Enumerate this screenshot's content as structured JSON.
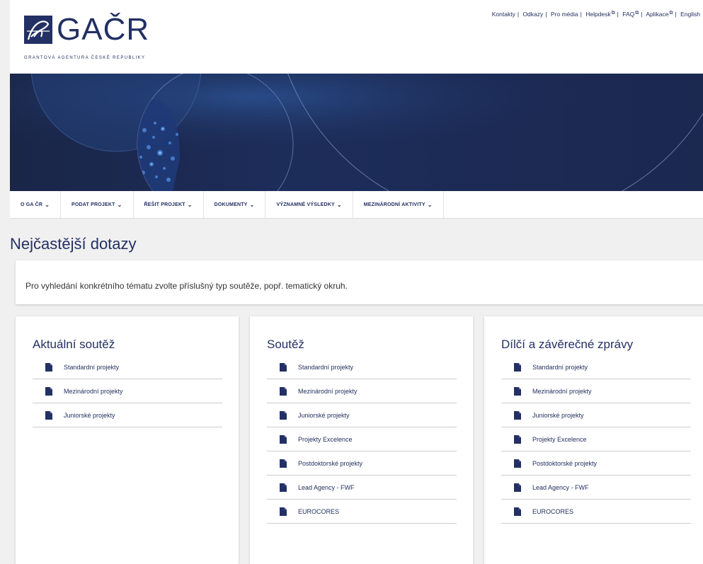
{
  "logo": {
    "name": "GAČR",
    "subtitle": "GRANTOVÁ AGENTURA ČESKÉ REPUBLIKY"
  },
  "toplinks": [
    {
      "label": "Kontakty",
      "external": false
    },
    {
      "label": "Odkazy",
      "external": false
    },
    {
      "label": "Pro média",
      "external": false
    },
    {
      "label": "Helpdesk",
      "external": true
    },
    {
      "label": "FAQ",
      "external": true
    },
    {
      "label": "Aplikace",
      "external": true
    },
    {
      "label": "English",
      "external": false
    }
  ],
  "nav": [
    {
      "label": "O GA ČR"
    },
    {
      "label": "PODAT PROJEKT"
    },
    {
      "label": "ŘEŠIT PROJEKT"
    },
    {
      "label": "DOKUMENTY"
    },
    {
      "label": "VÝZNAMNÉ VÝSLEDKY"
    },
    {
      "label": "MEZINÁRODNÍ AKTIVITY"
    }
  ],
  "page": {
    "title": "Nejčastější dotazy",
    "intro": "Pro vyhledání konkrétního tématu zvolte příslušný typ soutěže, popř. tematický okruh."
  },
  "cards": [
    {
      "title": "Aktuální soutěž",
      "links": [
        "Standardní projekty",
        "Mezinárodní projekty",
        "Juniorské projekty"
      ]
    },
    {
      "title": "Soutěž",
      "links": [
        "Standardní projekty",
        "Mezinárodní projekty",
        "Juniorské projekty",
        "Projekty Excelence",
        "Postdoktorské projekty",
        "Lead Agency - FWF",
        "EUROCORES"
      ]
    },
    {
      "title": "Dílčí a závěrečné zprávy",
      "links": [
        "Standardní projekty",
        "Mezinárodní projekty",
        "Juniorské projekty",
        "Projekty Excelence",
        "Postdoktorské projekty",
        "Lead Agency - FWF",
        "EUROCORES"
      ]
    }
  ],
  "colors": {
    "brand": "#233063",
    "banner": "#1b2850",
    "background": "#f0f0f0"
  },
  "icons": {
    "link": "document-icon",
    "nav": "chevron-down-icon",
    "external": "external-link-icon"
  }
}
